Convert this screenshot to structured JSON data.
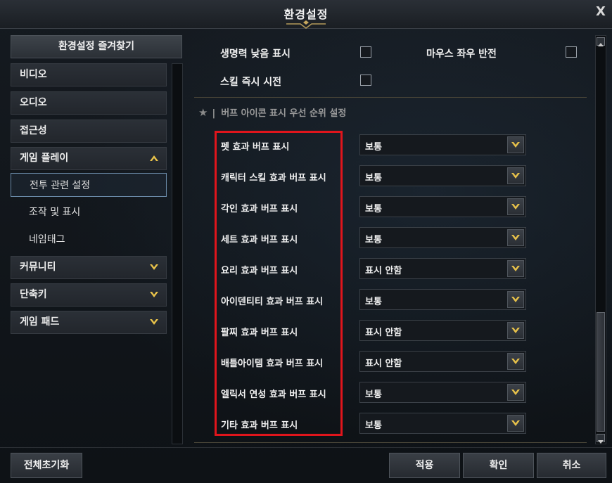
{
  "window": {
    "title": "환경설정",
    "close_label": "X"
  },
  "sidebar": {
    "favorites_label": "환경설정 즐겨찾기",
    "items": [
      {
        "label": "비디오"
      },
      {
        "label": "오디오"
      },
      {
        "label": "접근성"
      },
      {
        "label": "게임 플레이",
        "expanded": true
      },
      {
        "label": "커뮤니티"
      },
      {
        "label": "단축키"
      },
      {
        "label": "게임 패드"
      }
    ],
    "subitems": [
      {
        "label": "전투 관련 설정",
        "selected": true
      },
      {
        "label": "조작 및 표시"
      },
      {
        "label": "네임태그"
      }
    ]
  },
  "options": {
    "low_health": "생명력 낮음 표시",
    "mouse_invert": "마우스 좌우 반전",
    "instant_cast": "스킬 즉시 시전"
  },
  "buff_section": {
    "title": "버프 아이콘 표시 우선 순위 설정",
    "rows": [
      {
        "label": "펫 효과 버프 표시",
        "value": "보통"
      },
      {
        "label": "캐릭터 스킬 효과 버프 표시",
        "value": "보통"
      },
      {
        "label": "각인 효과 버프 표시",
        "value": "보통"
      },
      {
        "label": "세트 효과 버프 표시",
        "value": "보통"
      },
      {
        "label": "요리 효과 버프 표시",
        "value": "표시 안함"
      },
      {
        "label": "아이덴티티 효과 버프 표시",
        "value": "보통"
      },
      {
        "label": "팔찌 효과 버프 표시",
        "value": "표시 안함"
      },
      {
        "label": "배틀아이템 효과 버프 표시",
        "value": "표시 안함"
      },
      {
        "label": "엘릭서 연성 효과 버프 표시",
        "value": "보통"
      },
      {
        "label": "기타 효과 버프 표시",
        "value": "보통"
      }
    ]
  },
  "footer": {
    "reset_label": "전체초기화",
    "apply_label": "적용",
    "ok_label": "확인",
    "cancel_label": "취소"
  },
  "colors": {
    "highlight_box": "#e0151c",
    "chevron_gold": "#e8c24a"
  }
}
